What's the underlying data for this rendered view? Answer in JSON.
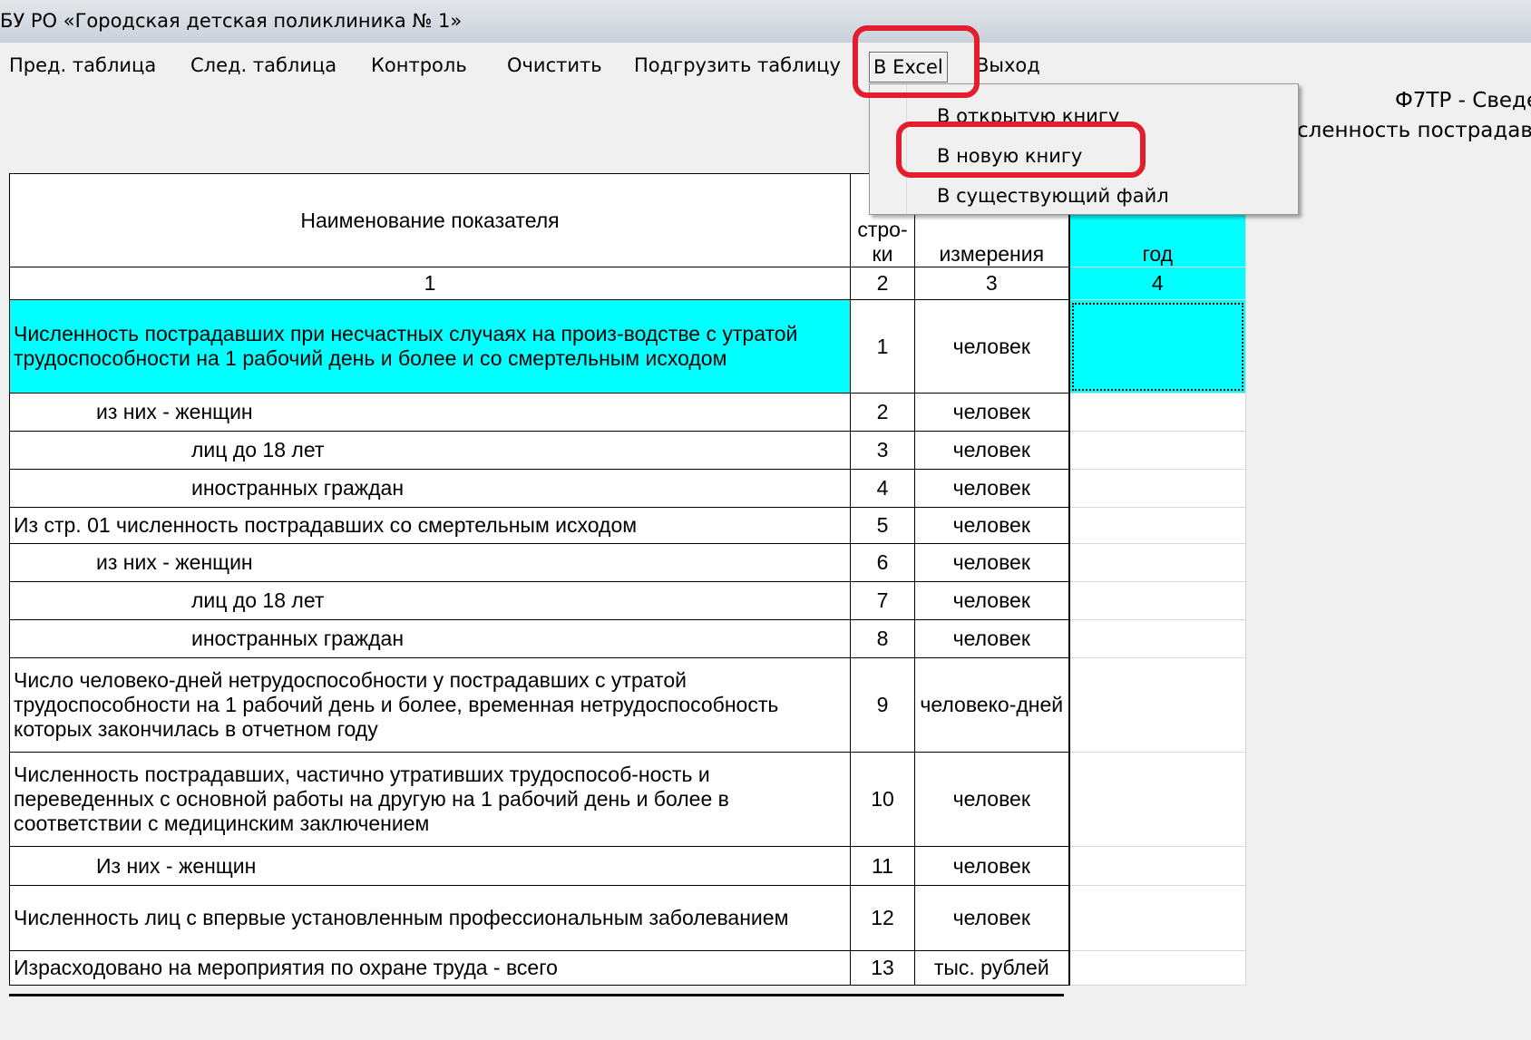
{
  "window": {
    "title": "БУ РО «Городская детская поликлиника № 1»"
  },
  "menu": {
    "items": [
      "Пред. таблица",
      "След. таблица",
      "Контроль",
      "Очистить",
      "Подгрузить таблицу",
      "В Excel",
      "Выход"
    ],
    "active": "В Excel"
  },
  "dropdown": {
    "items": [
      "В открытую книгу",
      "В новую книгу",
      "В существующий файл"
    ]
  },
  "header_right": {
    "line1": "Ф7ТР - Сведе",
    "line2": "сленность пострадав"
  },
  "table": {
    "headers": {
      "c1": "Наименование показателя",
      "c2": "стро-\nки",
      "c3": "измерения",
      "c4": "год"
    },
    "colnums": [
      "1",
      "2",
      "3",
      "4"
    ],
    "rows": [
      {
        "name": "Численность пострадавших при несчастных случаях на произ-водстве с утратой трудоспособности на 1 рабочий день и более и со смертельным исходом",
        "num": "1",
        "unit": "человек",
        "value": ""
      },
      {
        "name": "из них - женщин",
        "num": "2",
        "unit": "человек",
        "value": ""
      },
      {
        "name": "лиц до 18 лет",
        "num": "3",
        "unit": "человек",
        "value": ""
      },
      {
        "name": "иностранных граждан",
        "num": "4",
        "unit": "человек",
        "value": ""
      },
      {
        "name": "Из стр. 01 численность пострадавших со смертельным исходом",
        "num": "5",
        "unit": "человек",
        "value": ""
      },
      {
        "name": "из них - женщин",
        "num": "6",
        "unit": "человек",
        "value": ""
      },
      {
        "name": "лиц до 18 лет",
        "num": "7",
        "unit": "человек",
        "value": ""
      },
      {
        "name": "иностранных граждан",
        "num": "8",
        "unit": "человек",
        "value": ""
      },
      {
        "name": "Число человеко-дней нетрудоспособности у пострадавших с утратой трудоспособности на 1 рабочий день и более, временная нетрудоспособность которых закончилась в отчетном году",
        "num": "9",
        "unit": "человеко-дней",
        "value": ""
      },
      {
        "name": "Численность пострадавших, частично утративших трудоспособ-ность и переведенных с основной работы на другую на 1 рабочий день и более в соответствии с медицинским заключением",
        "num": "10",
        "unit": "человек",
        "value": ""
      },
      {
        "name": "Из них - женщин",
        "num": "11",
        "unit": "человек",
        "value": ""
      },
      {
        "name": "Численность лиц с впервые установленным профессиональным заболеванием",
        "num": "12",
        "unit": "человек",
        "value": ""
      },
      {
        "name": "Израсходовано на мероприятия по охране труда - всего",
        "num": "13",
        "unit": "тыс. рублей",
        "value": ""
      }
    ]
  },
  "colors": {
    "highlight": "#00ffff",
    "annotation": "#e31d2b"
  }
}
